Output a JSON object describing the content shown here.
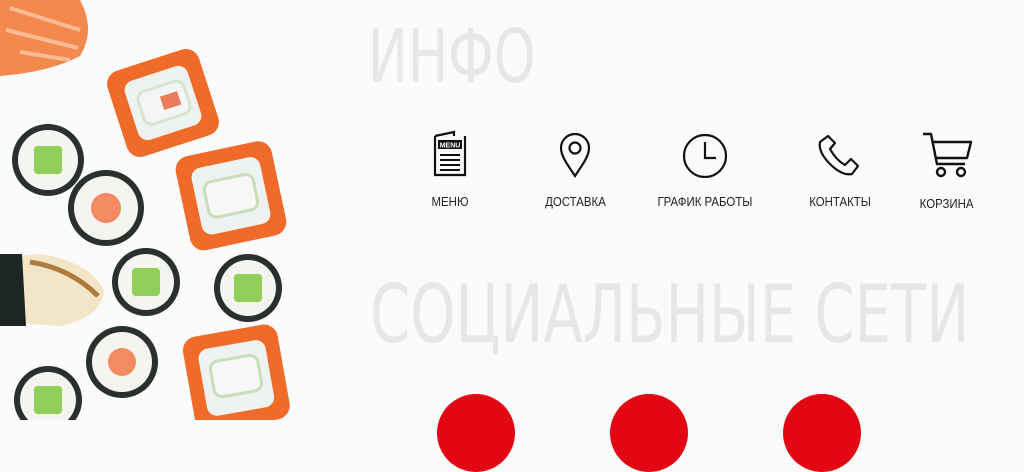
{
  "info": {
    "title": "ИНФО"
  },
  "nav": {
    "menu": {
      "label": "МЕНЮ",
      "icon_text": "MENU",
      "icon": "menu-book-icon"
    },
    "delivery": {
      "label": "ДОСТАВКА",
      "icon": "map-pin-icon"
    },
    "hours": {
      "label": "ГРАФИК РАБОТЫ",
      "icon": "clock-icon"
    },
    "contacts": {
      "label": "КОНТАКТЫ",
      "icon": "phone-icon"
    },
    "cart": {
      "label": "КОРЗИНА",
      "icon": "cart-icon"
    }
  },
  "social": {
    "title": "СОЦИАЛЬНЫЕ СЕТИ"
  },
  "colors": {
    "accent": "#e30613",
    "heading": "#e7e7e7",
    "text": "#222222"
  }
}
